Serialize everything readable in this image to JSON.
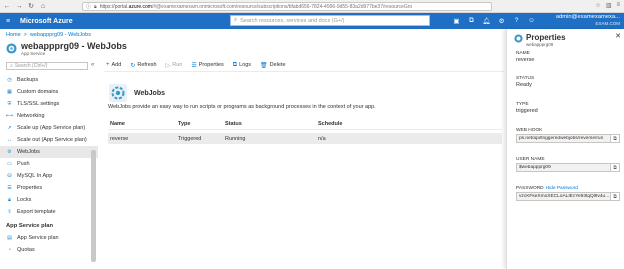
{
  "browser": {
    "url_prefix": "https://portal.",
    "url_host": "azure.com",
    "url_rest": "/#@examexamexam.onmicrosoft.com/resource/subscriptions/bfabd656-7824-4996-9d55-83a2d977be37/resourceGro"
  },
  "header": {
    "brand": "Microsoft Azure",
    "search_placeholder": "Search resources, services and docs (G+/)",
    "user_email": "admin@examexamexa...",
    "user_org": "EXAM.COM"
  },
  "breadcrumb": {
    "home": "Home",
    "sep": ">",
    "app": "webappprg09 - WebJobs"
  },
  "resource": {
    "title": "webappprg09 - WebJobs",
    "type": "App Service"
  },
  "left_nav": {
    "search_placeholder": "Search (Ctrl+/)",
    "collapse": "«",
    "items": [
      {
        "label": "Backups"
      },
      {
        "label": "Custom domains"
      },
      {
        "label": "TLS/SSL settings"
      },
      {
        "label": "Networking"
      },
      {
        "label": "Scale up (App Service plan)"
      },
      {
        "label": "Scale out (App Service plan)"
      },
      {
        "label": "WebJobs"
      },
      {
        "label": "Push"
      },
      {
        "label": "MySQL In App"
      },
      {
        "label": "Properties"
      },
      {
        "label": "Locks"
      },
      {
        "label": "Export template"
      }
    ],
    "section": "App Service plan",
    "section_items": [
      {
        "label": "App Service plan"
      },
      {
        "label": "Quotas"
      }
    ]
  },
  "toolbar": {
    "add": "Add",
    "refresh": "Refresh",
    "run": "Run",
    "properties": "Properties",
    "logs": "Logs",
    "delete": "Delete"
  },
  "main": {
    "title": "WebJobs",
    "description": "WebJobs provide an easy way to run scripts or programs as background processes in the context of your app.",
    "columns": [
      "Name",
      "Type",
      "Status",
      "Schedule"
    ],
    "rows": [
      [
        "reverse",
        "Triggered",
        "Running",
        "n/a"
      ]
    ]
  },
  "properties_panel": {
    "title": "Properties",
    "subtitle": "webappprg09",
    "close": "✕",
    "name_label": "NAME",
    "name_value": "reverse",
    "status_label": "STATUS",
    "status_value": "Ready",
    "type_label": "TYPE",
    "type_value": "triggered",
    "webhook_label": "WEB HOOK",
    "webhook_value": "ps.net/api/triggeredwebjobs/reverse/run",
    "username_label": "USER NAME",
    "username_value": "$webappprg09",
    "password_label": "PASSWORD",
    "password_hide": "Hide Password",
    "password_value": "vzcKFkeXmoXECLoALIEcYe93tqQl9v4u..."
  },
  "colors": {
    "azure_blue": "#1f6fc5",
    "link": "#0078d4"
  }
}
